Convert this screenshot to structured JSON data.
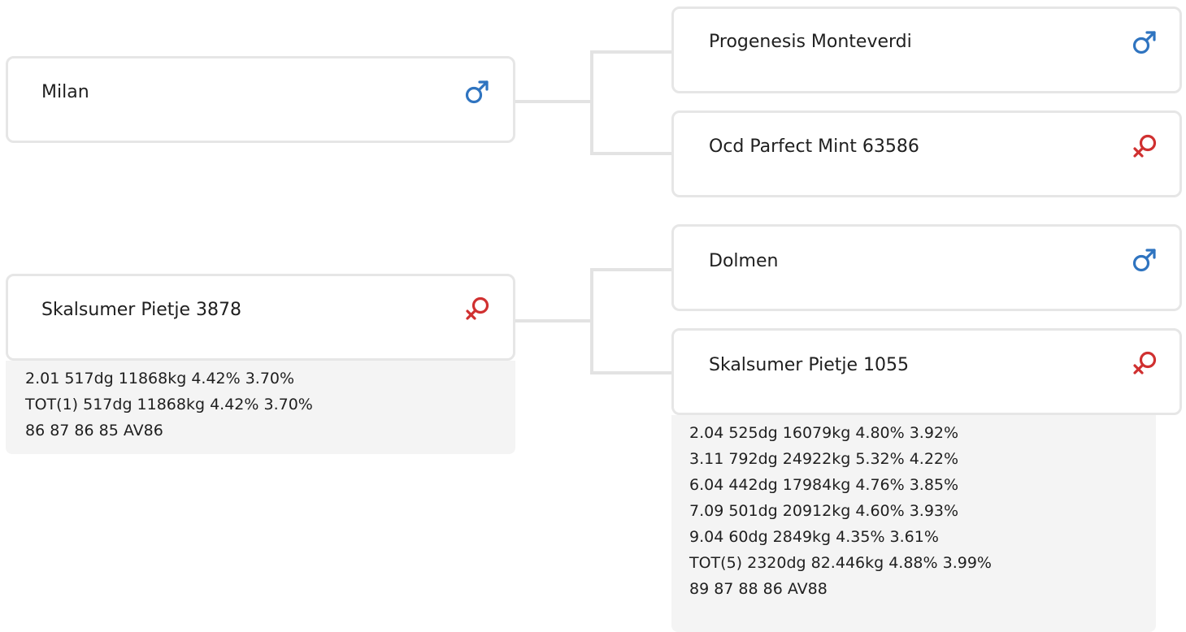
{
  "pedigree": {
    "sire": {
      "name": "Milan",
      "gender": "male",
      "gender_icon": "male-icon",
      "sire": {
        "name": "Progenesis Monteverdi",
        "gender": "male",
        "gender_icon": "male-icon"
      },
      "dam": {
        "name": "Ocd Parfect Mint 63586",
        "gender": "female",
        "gender_icon": "female-icon"
      }
    },
    "dam": {
      "name": "Skalsumer Pietje 3878",
      "gender": "female",
      "gender_icon": "female-icon",
      "stats": [
        "2.01 517dg 11868kg 4.42% 3.70%",
        "TOT(1) 517dg 11868kg 4.42% 3.70%",
        "86 87 86 85 AV86"
      ],
      "sire": {
        "name": "Dolmen",
        "gender": "male",
        "gender_icon": "male-icon"
      },
      "dam": {
        "name": "Skalsumer Pietje 1055",
        "gender": "female",
        "gender_icon": "female-icon",
        "stats": [
          "2.04 525dg 16079kg 4.80% 3.92%",
          "3.11 792dg 24922kg 5.32% 4.22%",
          "6.04 442dg 17984kg 4.76% 3.85%",
          "7.09 501dg 20912kg 4.60% 3.93%",
          "9.04 60dg 2849kg 4.35% 3.61%",
          "TOT(5) 2320dg 82.446kg 4.88% 3.99%",
          "89 87 88 86 AV88"
        ]
      }
    }
  },
  "colors": {
    "male": "#2f74c0",
    "female": "#d03030",
    "border": "#e6e6e6",
    "connector": "#e3e3e3",
    "stats_background": "#f4f4f4"
  }
}
